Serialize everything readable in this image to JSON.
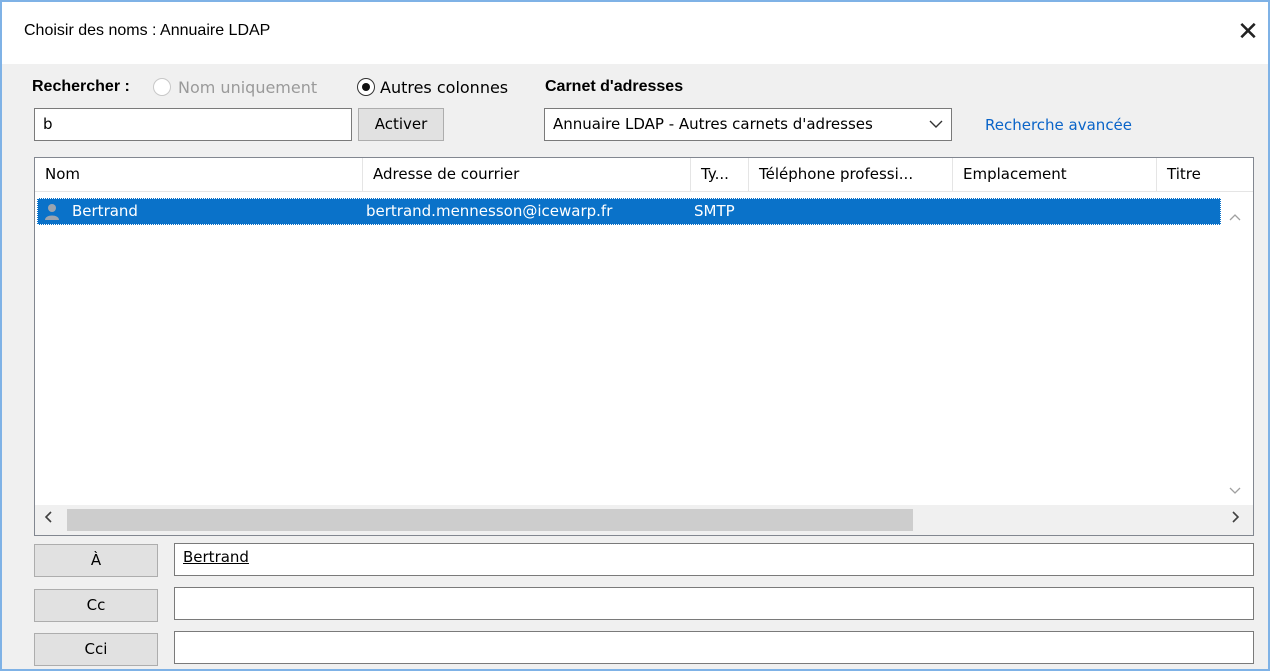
{
  "window": {
    "title": "Choisir des noms : Annuaire LDAP",
    "close_glyph": "✕"
  },
  "search": {
    "label": "Rechercher :",
    "option_name_only": "Nom uniquement",
    "option_other_columns": "Autres colonnes",
    "selected_option": "Autres colonnes",
    "value": "b",
    "go_button": "Activer"
  },
  "address_book": {
    "label": "Carnet d'adresses",
    "selected": "Annuaire LDAP - Autres carnets d'adresses",
    "advanced_link": "Recherche avancée"
  },
  "results": {
    "columns": [
      "Nom",
      "Adresse de courrier",
      "Ty...",
      "Téléphone professi...",
      "Emplacement",
      "Titre"
    ],
    "rows": [
      {
        "name": "Bertrand",
        "email": "bertrand.mennesson@icewarp.fr",
        "type": "SMTP",
        "phone": "",
        "location": "",
        "title": "",
        "selected": true
      }
    ]
  },
  "recipients": {
    "to_button": "À",
    "to_value": "Bertrand",
    "cc_button": "Cc",
    "cc_value": "",
    "bcc_button": "Cci",
    "bcc_value": ""
  },
  "colors": {
    "selection": "#0a72c9",
    "link": "#0a64c8",
    "window_border": "#7fb2e6"
  },
  "icons": {
    "close": "close-icon",
    "contact": "person-icon",
    "dropdown": "chevron-down-icon",
    "scroll_left": "arrow-left-icon",
    "scroll_right": "arrow-right-icon",
    "scroll_up": "arrow-up-icon",
    "scroll_down": "arrow-down-icon"
  }
}
